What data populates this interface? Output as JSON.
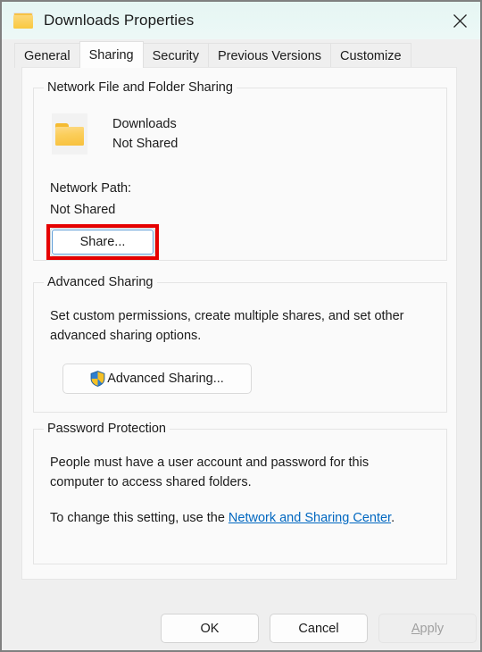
{
  "window": {
    "title": "Downloads Properties",
    "folder_icon": "folder-icon",
    "close_icon": "close-icon"
  },
  "tabs": [
    {
      "label": "General",
      "selected": false
    },
    {
      "label": "Sharing",
      "selected": true
    },
    {
      "label": "Security",
      "selected": false
    },
    {
      "label": "Previous Versions",
      "selected": false
    },
    {
      "label": "Customize",
      "selected": false
    }
  ],
  "groups": {
    "network": {
      "legend": "Network File and Folder Sharing",
      "folder_icon": "folder-icon",
      "folder_name": "Downloads",
      "folder_status": "Not Shared",
      "network_path_label": "Network Path:",
      "network_path_value": "Not Shared",
      "share_button": "Share...",
      "highlight_color": "#e60000"
    },
    "advanced": {
      "legend": "Advanced Sharing",
      "description": "Set custom permissions, create multiple shares, and set other advanced sharing options.",
      "button_label": "Advanced Sharing...",
      "button_icon": "uac-shield-icon"
    },
    "password": {
      "legend": "Password Protection",
      "description": "People must have a user account and password for this computer to access shared folders.",
      "change_prefix": "To change this setting, use the ",
      "link_text": "Network and Sharing Center",
      "change_suffix": ".",
      "link_color": "#0067c0"
    }
  },
  "footer": {
    "ok": "OK",
    "cancel": "Cancel",
    "apply_accel": "A",
    "apply_rest": "pply",
    "apply_enabled": false
  }
}
